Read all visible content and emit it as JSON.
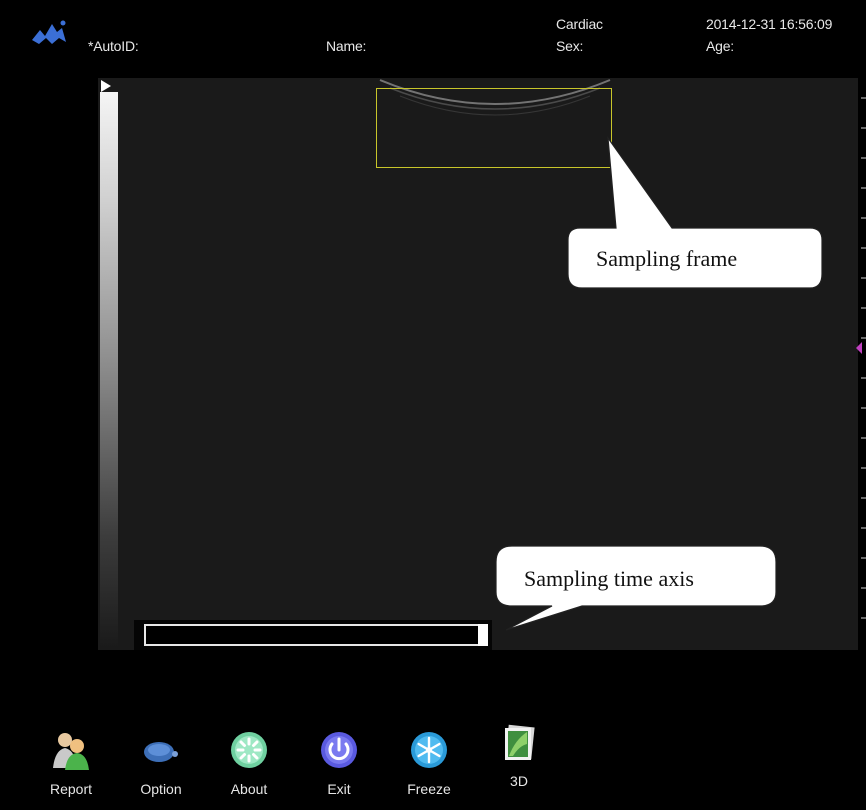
{
  "header": {
    "autoid_label": "*AutoID:",
    "name_label": "Name:",
    "mode": "Cardiac",
    "sex_label": "Sex:",
    "datetime": "2014-12-31 16:56:09",
    "age_label": "Age:"
  },
  "callouts": {
    "sampling_frame": "Sampling frame",
    "sampling_time_axis": "Sampling time axis"
  },
  "toolbar": {
    "items": [
      {
        "label": "Report",
        "icon": "report-icon"
      },
      {
        "label": "Option",
        "icon": "option-icon"
      },
      {
        "label": "About",
        "icon": "about-icon"
      },
      {
        "label": "Exit",
        "icon": "exit-icon"
      },
      {
        "label": "Freeze",
        "icon": "freeze-icon"
      },
      {
        "label": "3D",
        "icon": "3d-icon"
      }
    ]
  },
  "colors": {
    "sampling_frame": "#c8c62a",
    "ruler_marker": "#c040c0",
    "viewport_bg": "#1a1a1a"
  }
}
